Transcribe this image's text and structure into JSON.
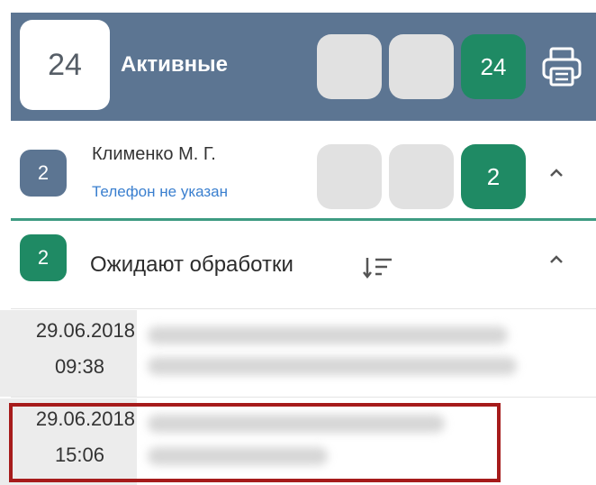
{
  "header": {
    "count": "24",
    "title": "Активные",
    "green_count": "24",
    "colors": {
      "bg": "#5c7592",
      "green": "#1f8a64",
      "grey": "#e1e1e1"
    },
    "print_icon": "printer-icon"
  },
  "doctor": {
    "badge": "2",
    "name": "Клименко М. Г.",
    "phone": "Телефон не указан",
    "green_count": "2",
    "chevron_icon": "chevron-up-icon"
  },
  "pending": {
    "badge": "2",
    "title": "Ожидают обработки",
    "sort_icon": "sort-icon",
    "chevron_icon": "chevron-up-icon"
  },
  "items": [
    {
      "date": "29.06.2018",
      "time": "09:38"
    },
    {
      "date": "29.06.2018",
      "time": "15:06"
    }
  ]
}
